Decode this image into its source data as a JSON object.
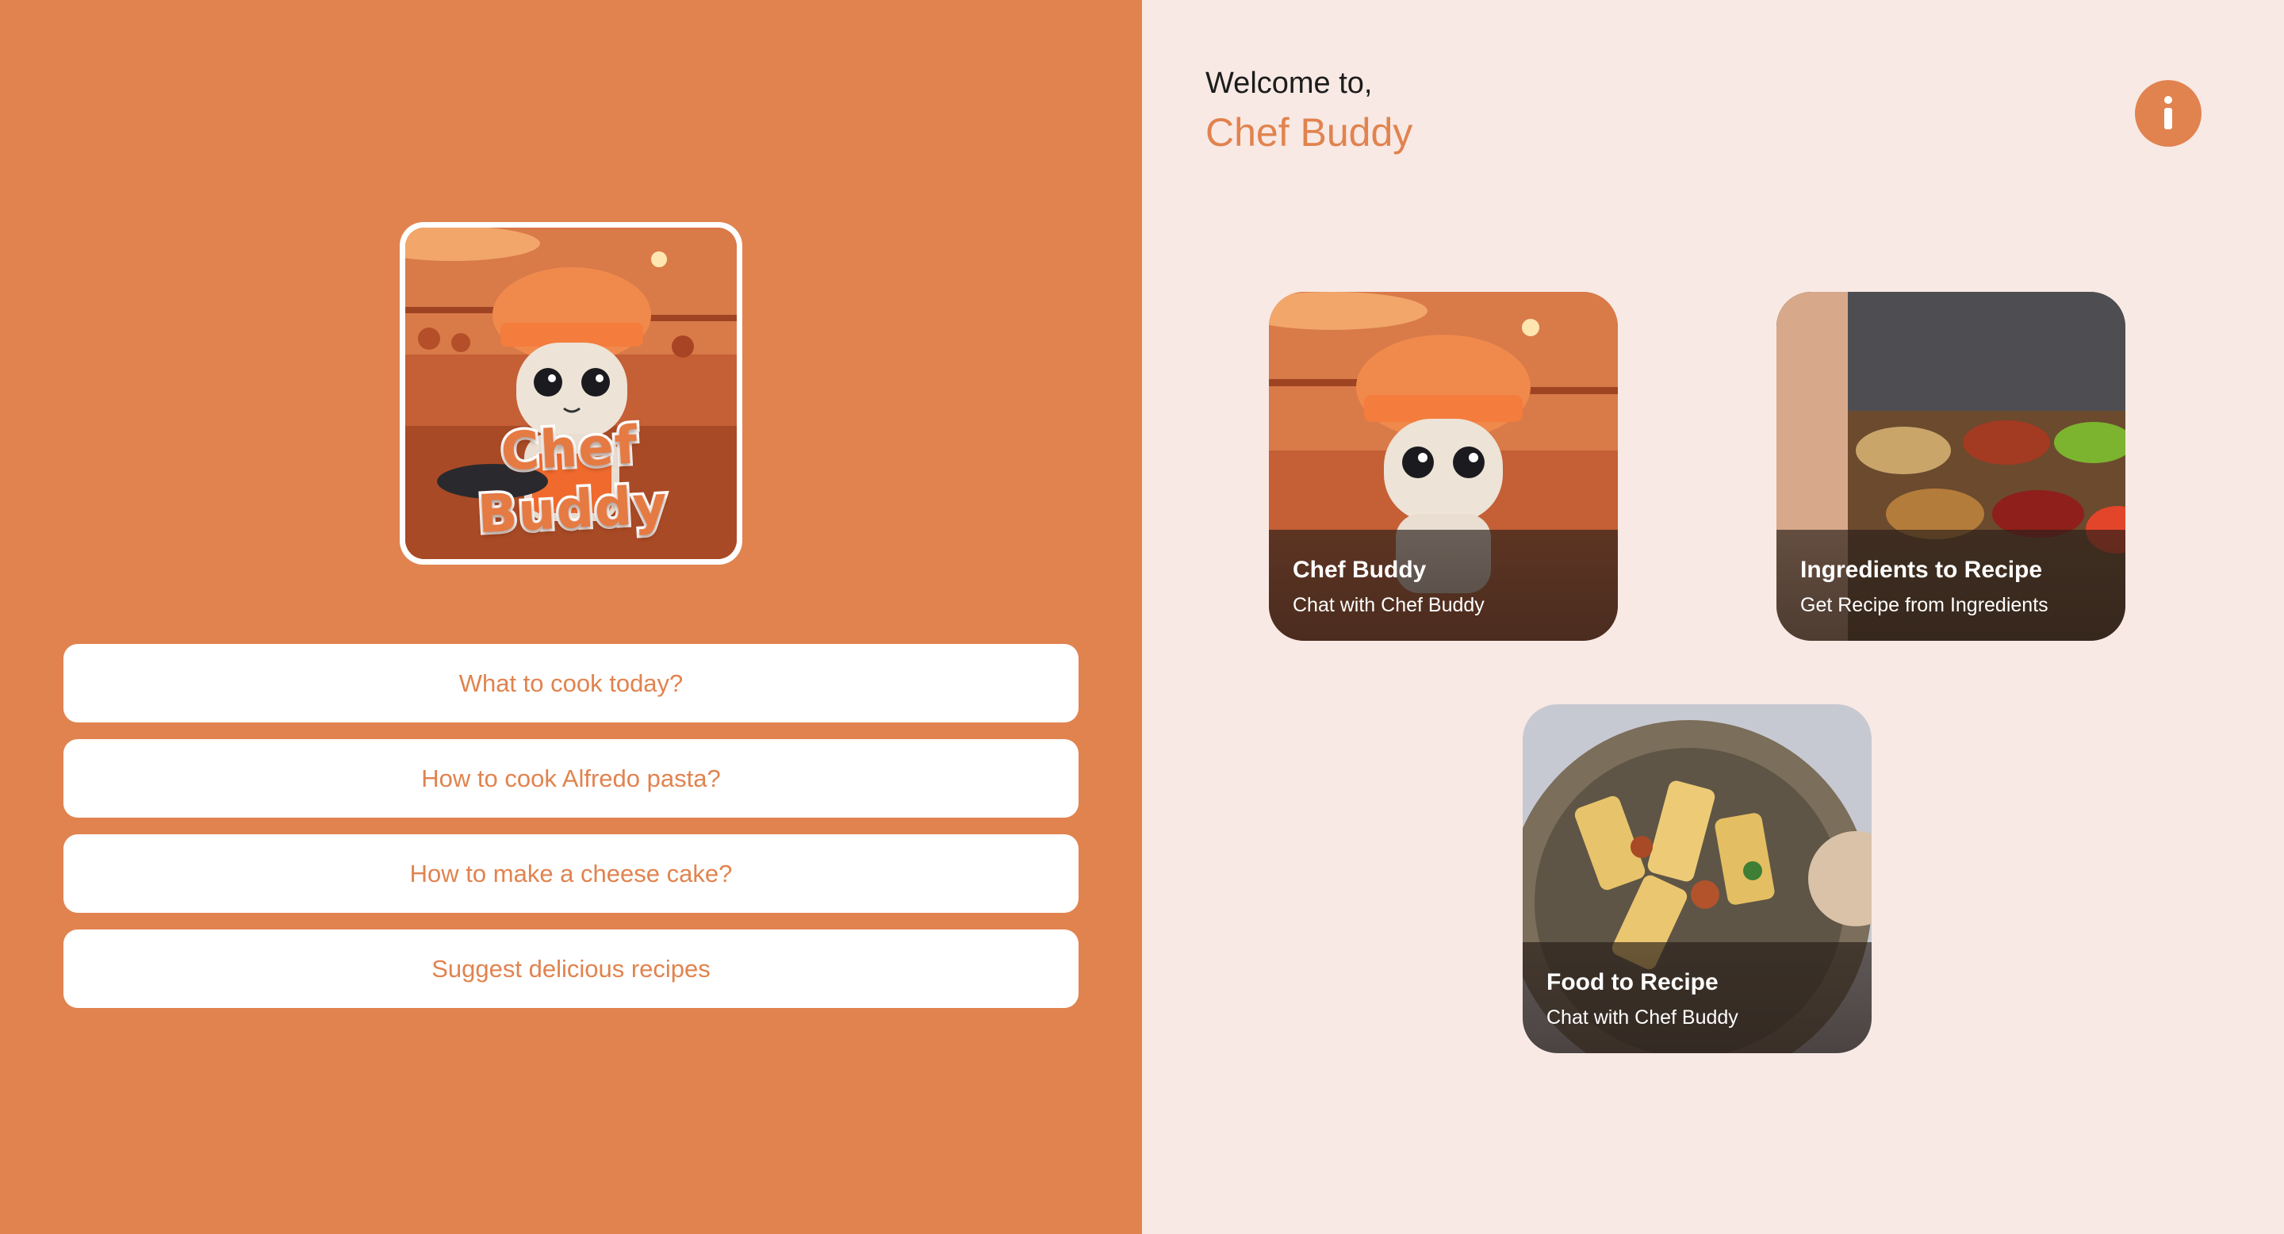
{
  "colors": {
    "accent": "#E1834F",
    "panel_right": "#F8E9E4",
    "button_bg": "#FFFFFF"
  },
  "logo": {
    "text": "Chef Buddy",
    "image": "robot-chef-in-kitchen"
  },
  "suggestions": [
    {
      "label": "What to cook today?"
    },
    {
      "label": "How to cook Alfredo pasta?"
    },
    {
      "label": "How to make a cheese cake?"
    },
    {
      "label": "Suggest delicious recipes"
    }
  ],
  "header": {
    "welcome": "Welcome to,",
    "title": "Chef Buddy",
    "info_icon": "info-icon"
  },
  "cards": [
    {
      "title": "Chef Buddy",
      "subtitle": "Chat with Chef Buddy",
      "image": "robot-chef-in-kitchen"
    },
    {
      "title": "Ingredients to Recipe",
      "subtitle": "Get Recipe from Ingredients",
      "image": "ingredient-bowls"
    },
    {
      "title": "Food to Recipe",
      "subtitle": "Chat with Chef Buddy",
      "image": "pasta-dish"
    }
  ]
}
